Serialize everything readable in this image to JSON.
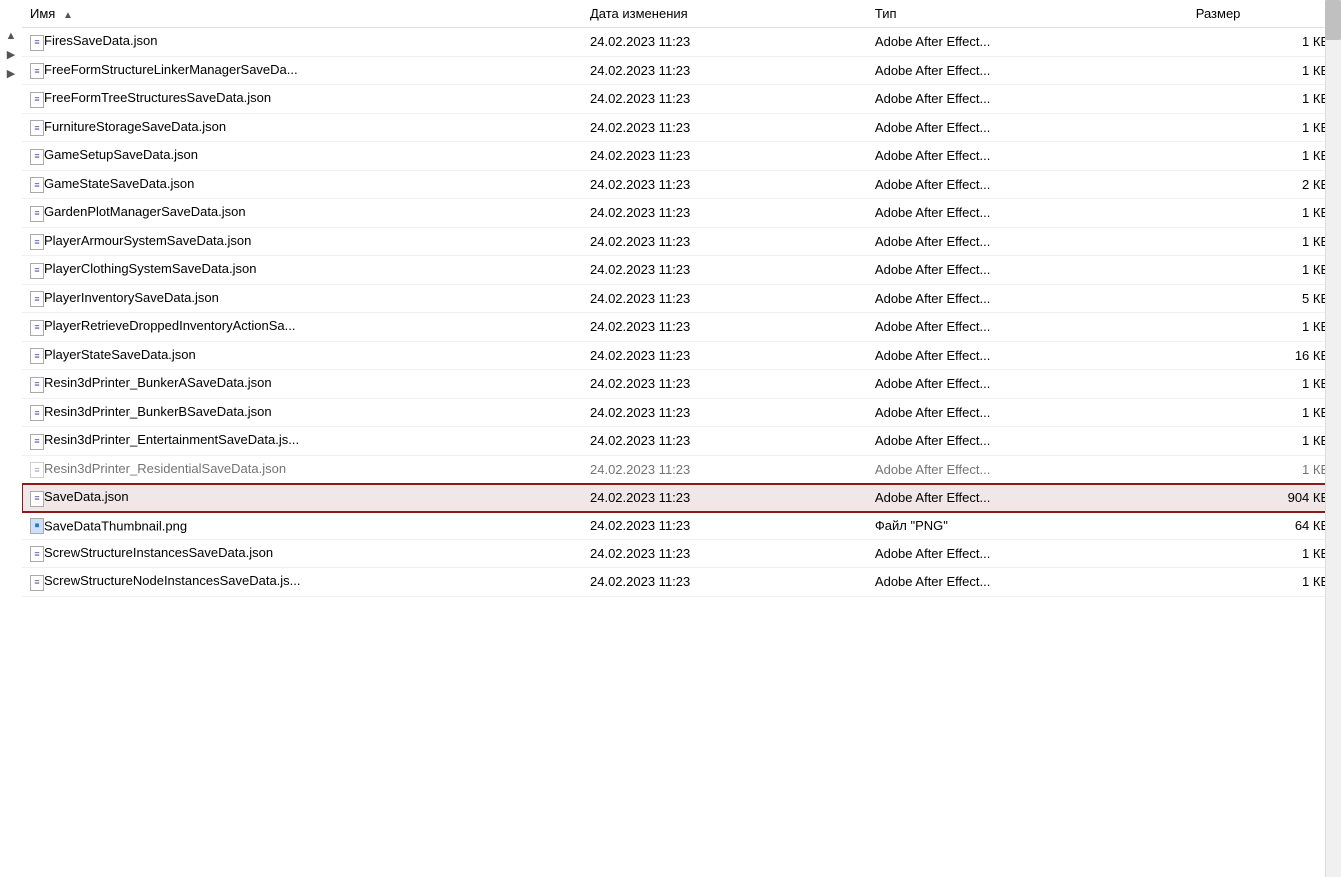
{
  "columns": [
    {
      "id": "name",
      "label": "Имя",
      "sortArrow": "▲"
    },
    {
      "id": "date",
      "label": "Дата изменения"
    },
    {
      "id": "type",
      "label": "Тип"
    },
    {
      "id": "size",
      "label": "Размер"
    }
  ],
  "files": [
    {
      "name": "FiresSaveData.json",
      "date": "24.02.2023 11:23",
      "type": "Adobe After Effect...",
      "size": "1 КБ",
      "icon": "json",
      "selected": false,
      "faded": false
    },
    {
      "name": "FreeFormStructureLinkerManagerSaveDa...",
      "date": "24.02.2023 11:23",
      "type": "Adobe After Effect...",
      "size": "1 КБ",
      "icon": "json",
      "selected": false,
      "faded": false
    },
    {
      "name": "FreeFormTreeStructuresSaveData.json",
      "date": "24.02.2023 11:23",
      "type": "Adobe After Effect...",
      "size": "1 КБ",
      "icon": "json",
      "selected": false,
      "faded": false
    },
    {
      "name": "FurnitureStorageSaveData.json",
      "date": "24.02.2023 11:23",
      "type": "Adobe After Effect...",
      "size": "1 КБ",
      "icon": "json",
      "selected": false,
      "faded": false
    },
    {
      "name": "GameSetupSaveData.json",
      "date": "24.02.2023 11:23",
      "type": "Adobe After Effect...",
      "size": "1 КБ",
      "icon": "json",
      "selected": false,
      "faded": false
    },
    {
      "name": "GameStateSaveData.json",
      "date": "24.02.2023 11:23",
      "type": "Adobe After Effect...",
      "size": "2 КБ",
      "icon": "json",
      "selected": false,
      "faded": false
    },
    {
      "name": "GardenPlotManagerSaveData.json",
      "date": "24.02.2023 11:23",
      "type": "Adobe After Effect...",
      "size": "1 КБ",
      "icon": "json",
      "selected": false,
      "faded": false
    },
    {
      "name": "PlayerArmourSystemSaveData.json",
      "date": "24.02.2023 11:23",
      "type": "Adobe After Effect...",
      "size": "1 КБ",
      "icon": "json",
      "selected": false,
      "faded": false
    },
    {
      "name": "PlayerClothingSystemSaveData.json",
      "date": "24.02.2023 11:23",
      "type": "Adobe After Effect...",
      "size": "1 КБ",
      "icon": "json",
      "selected": false,
      "faded": false
    },
    {
      "name": "PlayerInventorySaveData.json",
      "date": "24.02.2023 11:23",
      "type": "Adobe After Effect...",
      "size": "5 КБ",
      "icon": "json",
      "selected": false,
      "faded": false
    },
    {
      "name": "PlayerRetrieveDroppedInventoryActionSa...",
      "date": "24.02.2023 11:23",
      "type": "Adobe After Effect...",
      "size": "1 КБ",
      "icon": "json",
      "selected": false,
      "faded": false
    },
    {
      "name": "PlayerStateSaveData.json",
      "date": "24.02.2023 11:23",
      "type": "Adobe After Effect...",
      "size": "16 КБ",
      "icon": "json",
      "selected": false,
      "faded": false
    },
    {
      "name": "Resin3dPrinter_BunkerASaveData.json",
      "date": "24.02.2023 11:23",
      "type": "Adobe After Effect...",
      "size": "1 КБ",
      "icon": "json",
      "selected": false,
      "faded": false
    },
    {
      "name": "Resin3dPrinter_BunkerBSaveData.json",
      "date": "24.02.2023 11:23",
      "type": "Adobe After Effect...",
      "size": "1 КБ",
      "icon": "json",
      "selected": false,
      "faded": false
    },
    {
      "name": "Resin3dPrinter_EntertainmentSaveData.js...",
      "date": "24.02.2023 11:23",
      "type": "Adobe After Effect...",
      "size": "1 КБ",
      "icon": "json",
      "selected": false,
      "faded": false
    },
    {
      "name": "Resin3dPrinter_ResidentialSaveData.json",
      "date": "24.02.2023 11:23",
      "type": "Adobe After Effect...",
      "size": "1 КБ",
      "icon": "json",
      "selected": false,
      "faded": true
    },
    {
      "name": "SaveData.json",
      "date": "24.02.2023 11:23",
      "type": "Adobe After Effect...",
      "size": "904 КБ",
      "icon": "json",
      "selected": true,
      "faded": false
    },
    {
      "name": "SaveDataThumbnail.png",
      "date": "24.02.2023 11:23",
      "type": "Файл \"PNG\"",
      "size": "64 КБ",
      "icon": "png",
      "selected": false,
      "faded": false
    },
    {
      "name": "ScrewStructureInstancesSaveData.json",
      "date": "24.02.2023 11:23",
      "type": "Adobe After Effect...",
      "size": "1 КБ",
      "icon": "json",
      "selected": false,
      "faded": false
    },
    {
      "name": "ScrewStructureNodeInstancesSaveData.js...",
      "date": "24.02.2023 11:23",
      "type": "Adobe After Effect...",
      "size": "1 КБ",
      "icon": "json",
      "selected": false,
      "faded": false
    }
  ],
  "scrollArrows": [
    "▲",
    "▶",
    "▶"
  ]
}
